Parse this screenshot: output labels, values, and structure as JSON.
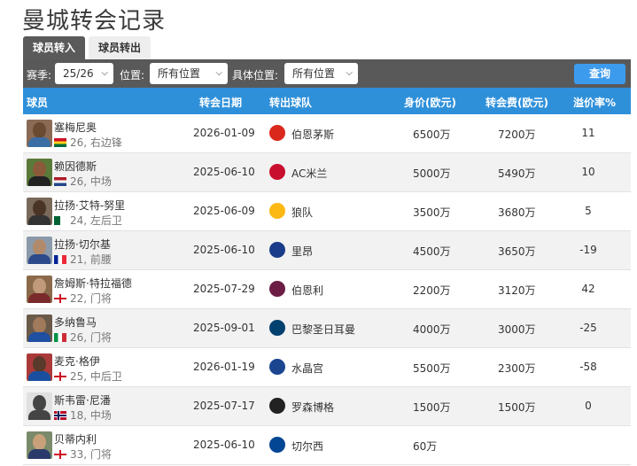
{
  "page": {
    "title": "曼城转会记录"
  },
  "tabs": [
    {
      "label": "球员转入",
      "active": true
    },
    {
      "label": "球员转出",
      "active": false
    }
  ],
  "filters": {
    "season_label": "赛季:",
    "season_value": "25/26",
    "position_label": "位置:",
    "position_value": "所有位置",
    "specific_label": "具体位置:",
    "specific_value": "所有位置",
    "query_label": "查询"
  },
  "table": {
    "headers": {
      "player": "球员",
      "date": "转会日期",
      "club": "转出球队",
      "value": "身价(欧元)",
      "fee": "转会费(欧元)",
      "rate": "溢价率%"
    },
    "rows": [
      {
        "name": "塞梅尼奥",
        "info": "26, 右边锋",
        "flag": "ghana",
        "date": "2026-01-09",
        "club": "伯恩茅斯",
        "club_icon": "bournemouth-icon",
        "value": "6500万",
        "fee": "7200万",
        "rate": "11"
      },
      {
        "name": "赖因德斯",
        "info": "26, 中场",
        "flag": "netherlands",
        "date": "2025-06-10",
        "club": "AC米兰",
        "club_icon": "ac-milan-icon",
        "value": "5000万",
        "fee": "5490万",
        "rate": "10"
      },
      {
        "name": "拉扬·艾特-努里",
        "info": "24, 左后卫",
        "flag": "algeria",
        "date": "2025-06-09",
        "club": "狼队",
        "club_icon": "wolves-icon",
        "value": "3500万",
        "fee": "3680万",
        "rate": "5"
      },
      {
        "name": "拉扬·切尔基",
        "info": "21, 前腰",
        "flag": "france",
        "date": "2025-06-10",
        "club": "里昂",
        "club_icon": "lyon-icon",
        "value": "4500万",
        "fee": "3650万",
        "rate": "-19"
      },
      {
        "name": "詹姆斯·特拉福德",
        "info": "22, 门将",
        "flag": "england",
        "date": "2025-07-29",
        "club": "伯恩利",
        "club_icon": "burnley-icon",
        "value": "2200万",
        "fee": "3120万",
        "rate": "42"
      },
      {
        "name": "多纳鲁马",
        "info": "26, 门将",
        "flag": "italy",
        "date": "2025-09-01",
        "club": "巴黎圣日耳曼",
        "club_icon": "psg-icon",
        "value": "4000万",
        "fee": "3000万",
        "rate": "-25"
      },
      {
        "name": "麦克·格伊",
        "info": "25, 中后卫",
        "flag": "england",
        "date": "2026-01-19",
        "club": "水晶宫",
        "club_icon": "crystal-palace-icon",
        "value": "5500万",
        "fee": "2300万",
        "rate": "-58"
      },
      {
        "name": "斯韦雷·尼潘",
        "info": "18, 中场",
        "flag": "norway",
        "date": "2025-07-17",
        "club": "罗森博格",
        "club_icon": "rosenborg-icon",
        "value": "1500万",
        "fee": "1500万",
        "rate": "0"
      },
      {
        "name": "贝蒂内利",
        "info": "33, 门将",
        "flag": "england",
        "date": "2025-06-10",
        "club": "切尔西",
        "club_icon": "chelsea-icon",
        "value": "60万",
        "fee": "",
        "rate": ""
      }
    ]
  },
  "colors": {
    "header_blue": "#2f90da",
    "filter_bar": "#595959",
    "query_button": "#3d9bee"
  }
}
